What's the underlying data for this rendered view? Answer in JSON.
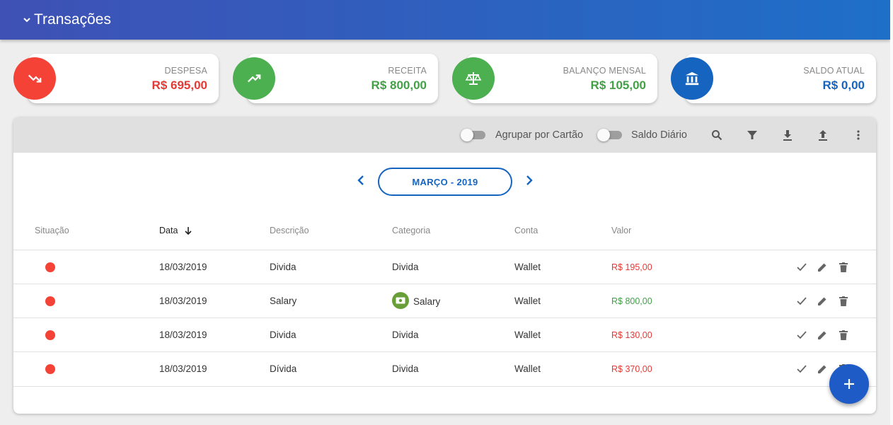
{
  "header": {
    "title": "Transações",
    "icon": "chevron-down-icon"
  },
  "cards": [
    {
      "label": "DESPESA",
      "value": "R$ 695,00",
      "color": "#f44336",
      "value_color": "#e53935",
      "icon": "trending-down-icon"
    },
    {
      "label": "RECEITA",
      "value": "R$ 800,00",
      "color": "#4caf50",
      "value_color": "#43a047",
      "icon": "trending-up-icon"
    },
    {
      "label": "BALANÇO MENSAL",
      "value": "R$ 105,00",
      "color": "#4caf50",
      "value_color": "#43a047",
      "icon": "scale-icon"
    },
    {
      "label": "SALDO ATUAL",
      "value": "R$ 0,00",
      "color": "#1565c0",
      "value_color": "#1565c0",
      "icon": "bank-icon"
    }
  ],
  "toolbar": {
    "group_by_card_label": "Agrupar por Cartão",
    "daily_balance_label": "Saldo Diário"
  },
  "month": {
    "label": "MARÇO - 2019"
  },
  "table": {
    "columns": [
      "Situação",
      "Data",
      "Descrição",
      "Categoria",
      "Conta",
      "Valor"
    ],
    "rows": [
      {
        "date": "18/03/2019",
        "description": "Divida",
        "category": "Divida",
        "account": "Wallet",
        "value": "R$ 195,00",
        "type": "expense"
      },
      {
        "date": "18/03/2019",
        "description": "Salary",
        "category": "Salary",
        "account": "Wallet",
        "value": "R$ 800,00",
        "type": "income"
      },
      {
        "date": "18/03/2019",
        "description": "Divida",
        "category": "Divida",
        "account": "Wallet",
        "value": "R$ 130,00",
        "type": "expense"
      },
      {
        "date": "18/03/2019",
        "description": "Dívida",
        "category": "Divida",
        "account": "Wallet",
        "value": "R$ 370,00",
        "type": "expense"
      }
    ]
  },
  "colors": {
    "accent": "#1565c0",
    "expense": "#e53935",
    "income": "#43a047"
  }
}
